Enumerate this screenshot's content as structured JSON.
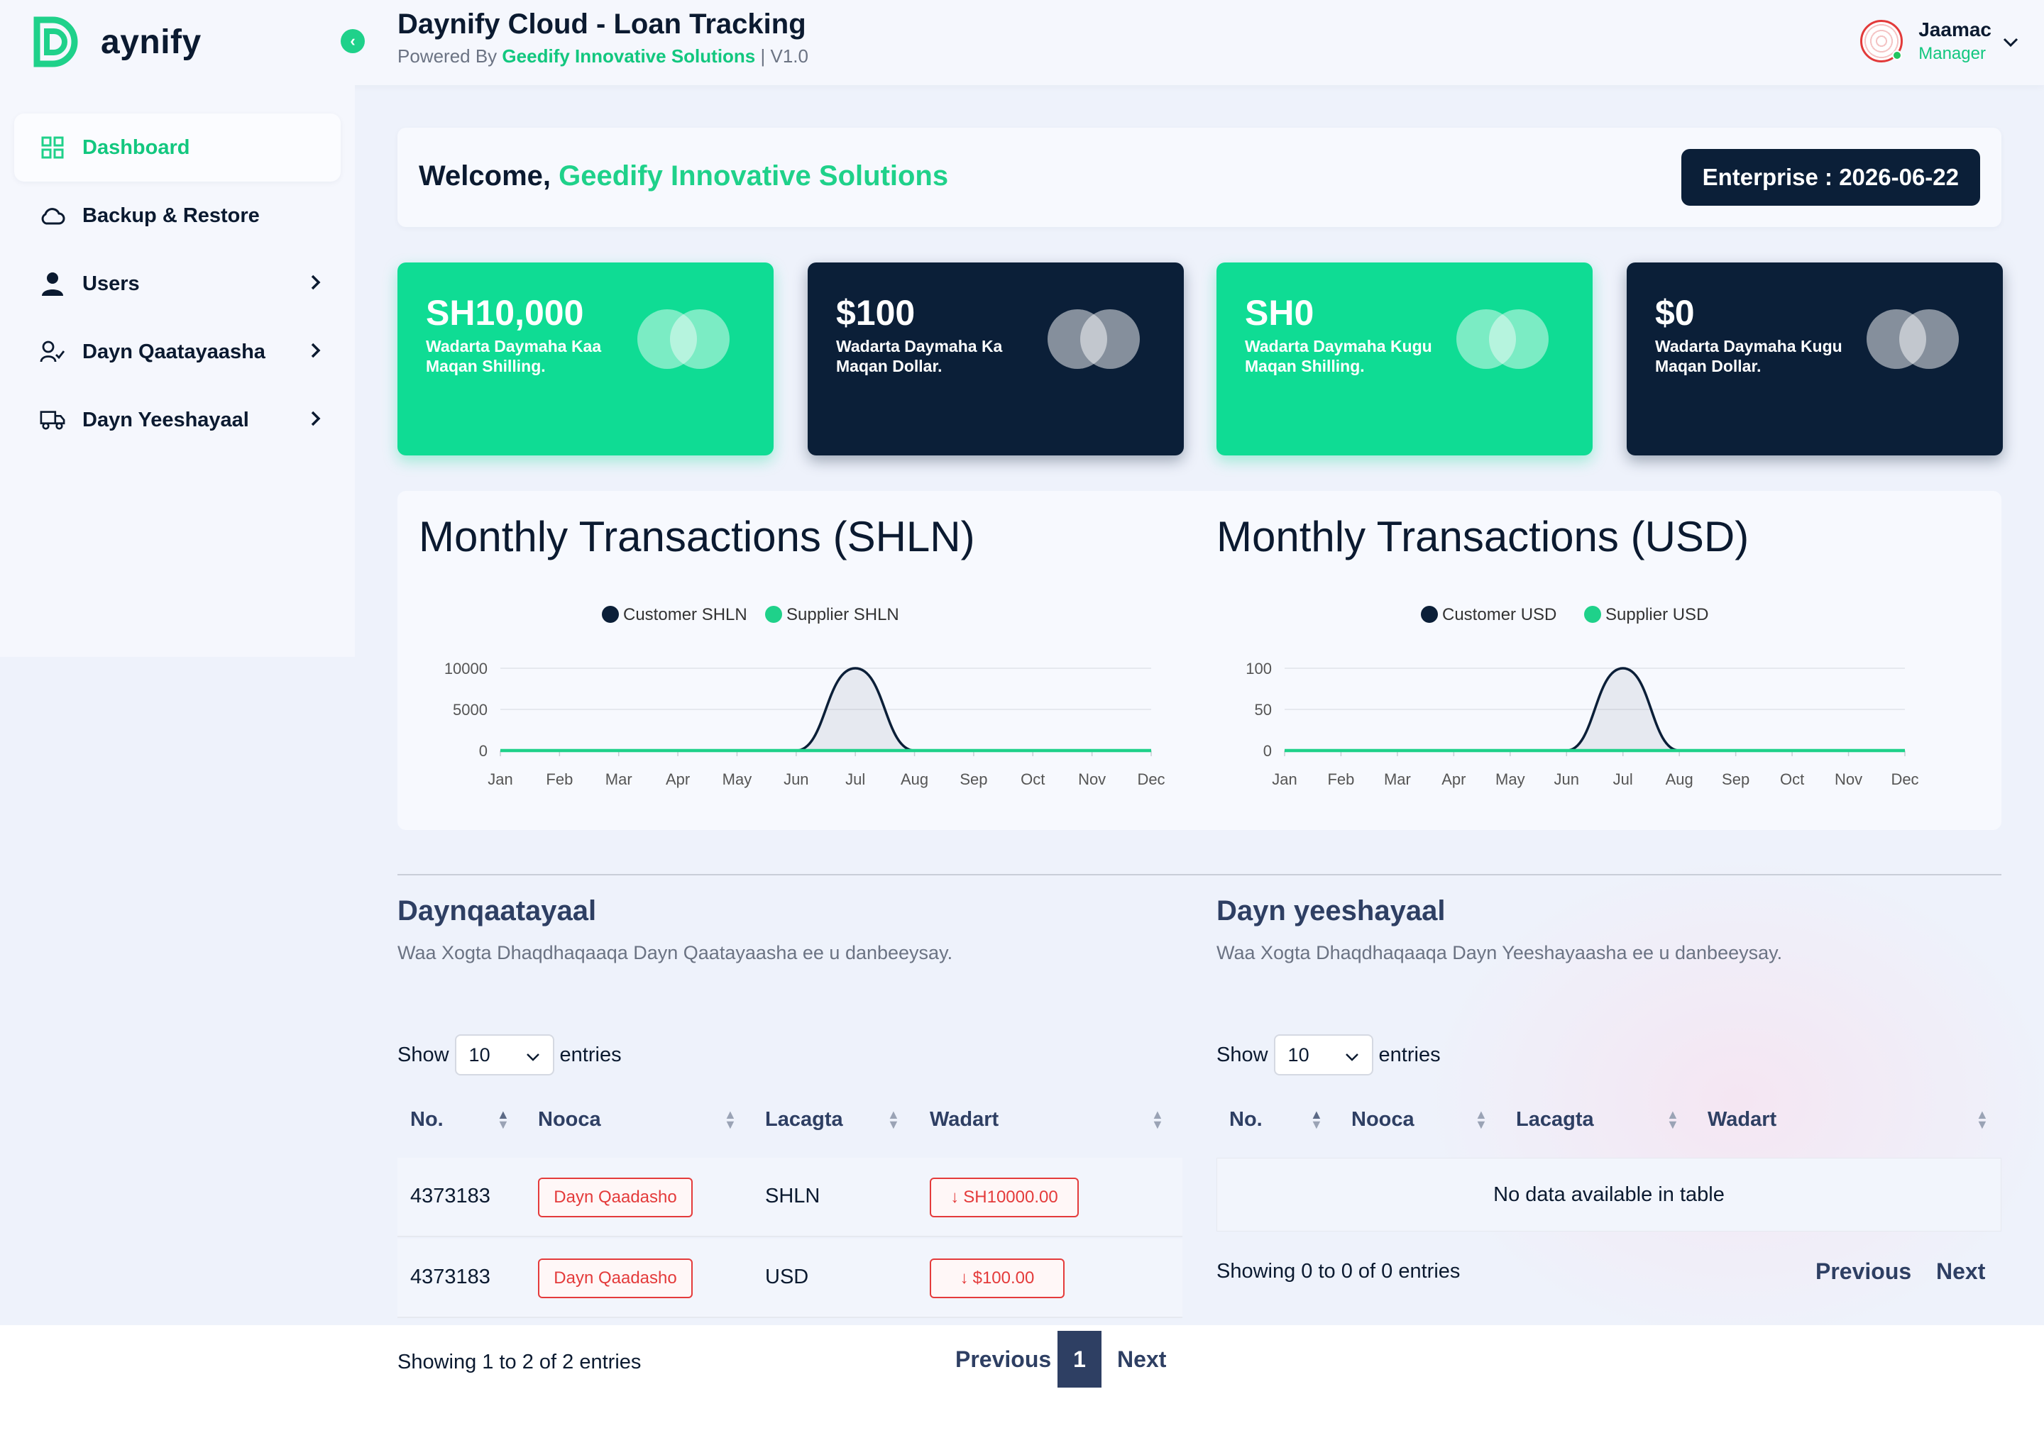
{
  "app": {
    "logo_text": "aynify",
    "title": "Daynify Cloud - Loan Tracking",
    "powered_prefix": "Powered By",
    "powered_brand": "Geedify Innovative Solutions",
    "version": "| V1.0"
  },
  "user": {
    "name": "Jaamac",
    "role": "Manager"
  },
  "sidebar": {
    "items": [
      {
        "label": "Dashboard",
        "icon": "grid-icon",
        "active": true
      },
      {
        "label": "Backup & Restore",
        "icon": "cloud-icon"
      },
      {
        "label": "Users",
        "icon": "user-icon"
      },
      {
        "label": "Dayn Qaatayaasha",
        "icon": "user-check-icon"
      },
      {
        "label": "Dayn Yeeshayaal",
        "icon": "truck-icon"
      }
    ]
  },
  "welcome": {
    "prefix": "Welcome,",
    "org": "Geedify Innovative Solutions",
    "plan": "Enterprise : 2026-06-22"
  },
  "stats": [
    {
      "value": "SH10,000",
      "label": "Wadarta Daymaha Kaa Maqan Shilling.",
      "theme": "green"
    },
    {
      "value": "$100",
      "label": "Wadarta Daymaha Ka Maqan Dollar.",
      "theme": "navy"
    },
    {
      "value": "SH0",
      "label": "Wadarta Daymaha Kugu Maqan Shilling.",
      "theme": "green"
    },
    {
      "value": "$0",
      "label": "Wadarta Daymaha Kugu Maqan Dollar.",
      "theme": "navy"
    }
  ],
  "colors": {
    "accent": "#1fd18a",
    "navy": "#0b1f38",
    "danger": "#e43b3b",
    "heading": "#2e3f63"
  },
  "chart_data": [
    {
      "type": "area",
      "title": "Monthly Transactions (SHLN)",
      "categories": [
        "Jan",
        "Feb",
        "Mar",
        "Apr",
        "May",
        "Jun",
        "Jul",
        "Aug",
        "Sep",
        "Oct",
        "Nov",
        "Dec"
      ],
      "series": [
        {
          "name": "Customer SHLN",
          "color": "#0b1f38",
          "values": [
            0,
            0,
            0,
            0,
            0,
            0,
            10000,
            0,
            0,
            0,
            0,
            0
          ]
        },
        {
          "name": "Supplier SHLN",
          "color": "#1fd18a",
          "values": [
            0,
            0,
            0,
            0,
            0,
            0,
            0,
            0,
            0,
            0,
            0,
            0
          ]
        }
      ],
      "yticks": [
        "0",
        "5000",
        "10000"
      ],
      "ylim": [
        0,
        10000
      ],
      "legend": "top-center",
      "grid": true
    },
    {
      "type": "area",
      "title": "Monthly Transactions (USD)",
      "categories": [
        "Jan",
        "Feb",
        "Mar",
        "Apr",
        "May",
        "Jun",
        "Jul",
        "Aug",
        "Sep",
        "Oct",
        "Nov",
        "Dec"
      ],
      "series": [
        {
          "name": "Customer USD",
          "color": "#0b1f38",
          "values": [
            0,
            0,
            0,
            0,
            0,
            0,
            100,
            0,
            0,
            0,
            0,
            0
          ]
        },
        {
          "name": "Supplier USD",
          "color": "#1fd18a",
          "values": [
            0,
            0,
            0,
            0,
            0,
            0,
            0,
            0,
            0,
            0,
            0,
            0
          ]
        }
      ],
      "yticks": [
        "0",
        "50",
        "100"
      ],
      "ylim": [
        0,
        100
      ],
      "legend": "top-center",
      "grid": true
    }
  ],
  "tables": {
    "left": {
      "title": "Daynqaatayaal",
      "desc": "Waa Xogta Dhaqdhaqaaqa Dayn Qaatayaasha ee u danbeeysay.",
      "show": "Show",
      "entries": "entries",
      "page_size": "10",
      "columns": [
        "No.",
        "Nooca",
        "Lacagta",
        "Wadart"
      ],
      "rows": [
        {
          "no": "4373183",
          "type": "Dayn Qaadasho",
          "currency": "SHLN",
          "amount": "SH10000.00"
        },
        {
          "no": "4373183",
          "type": "Dayn Qaadasho",
          "currency": "USD",
          "amount": "$100.00"
        }
      ],
      "info": "Showing 1 to 2 of 2 entries",
      "prev": "Previous",
      "page": "1",
      "next": "Next"
    },
    "right": {
      "title": "Dayn yeeshayaal",
      "desc": "Waa Xogta Dhaqdhaqaaqa Dayn Yeeshayaasha ee u danbeeysay.",
      "show": "Show",
      "entries": "entries",
      "page_size": "10",
      "columns": [
        "No.",
        "Nooca",
        "Lacagta",
        "Wadart"
      ],
      "empty": "No data available in table",
      "info": "Showing 0 to 0 of 0 entries",
      "prev": "Previous",
      "next": "Next"
    }
  }
}
